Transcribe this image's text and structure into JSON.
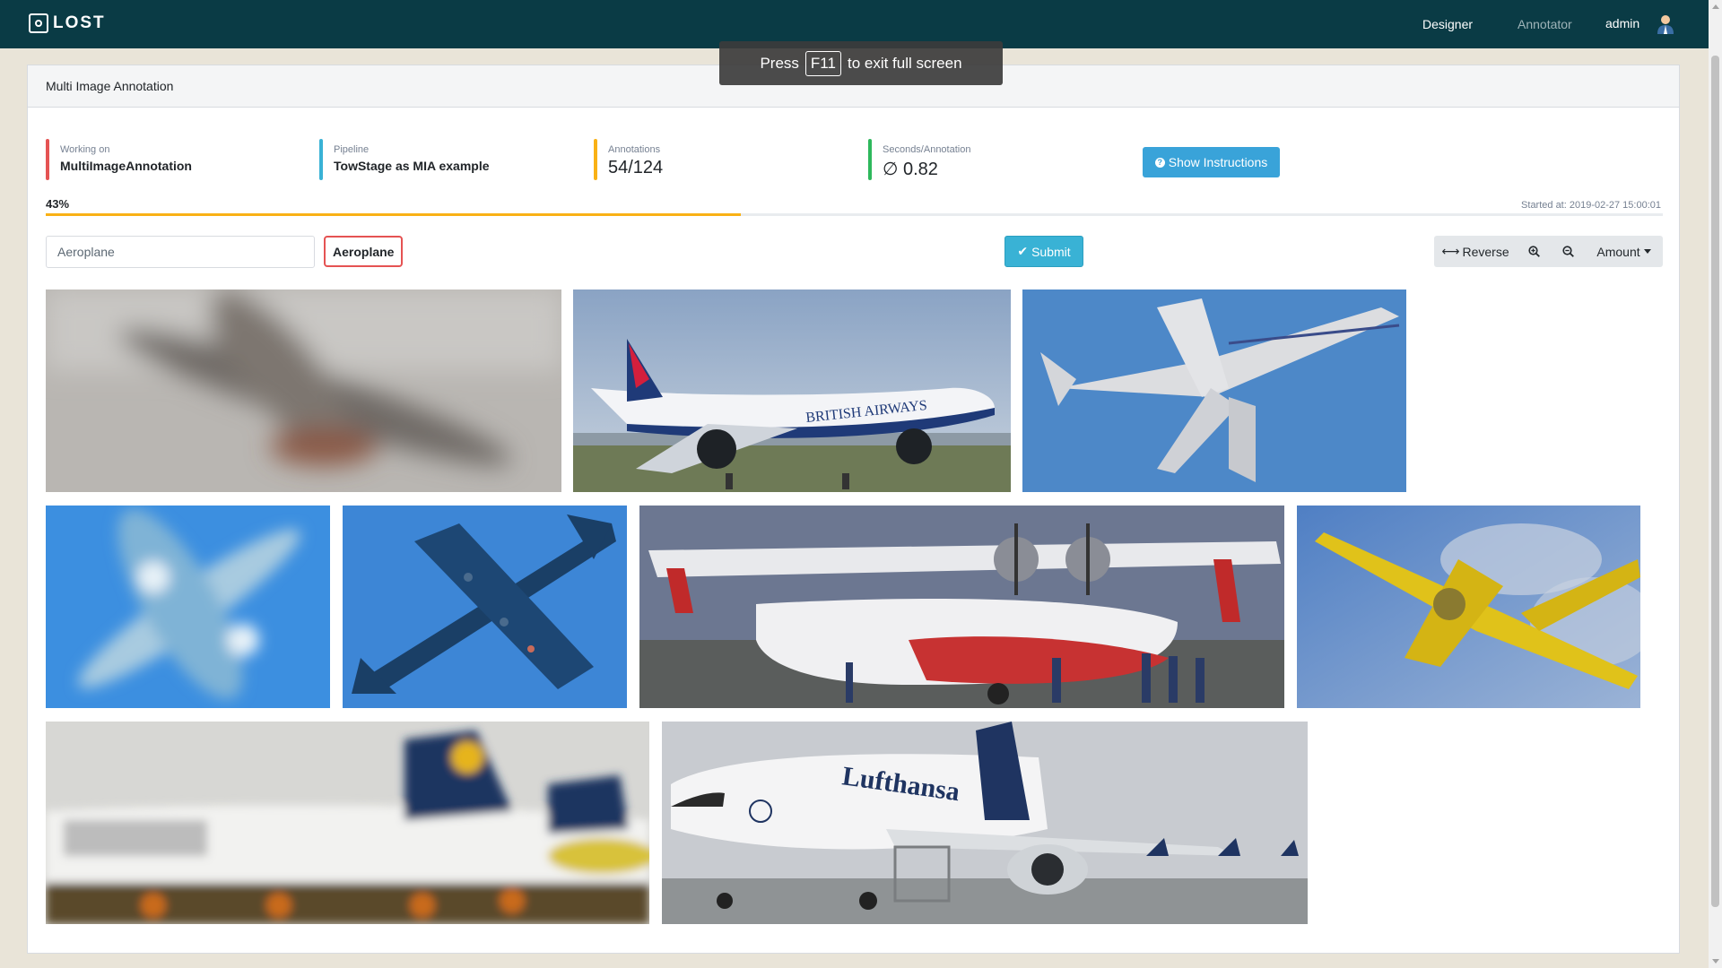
{
  "app": {
    "logo_text": "LOST"
  },
  "nav": {
    "designer": "Designer",
    "annotator": "Annotator",
    "user": "admin"
  },
  "fullscreen_toast": {
    "before": "Press",
    "key": "F11",
    "after": "to exit full screen"
  },
  "card": {
    "title": "Multi Image Annotation"
  },
  "stats": {
    "working_on": {
      "label": "Working on",
      "value": "MultiImageAnnotation"
    },
    "pipeline": {
      "label": "Pipeline",
      "value": "TowStage as MIA example"
    },
    "annotations": {
      "label": "Annotations",
      "value": "54/124"
    },
    "seconds": {
      "label": "Seconds/Annotation",
      "value": "∅ 0.82"
    }
  },
  "buttons": {
    "show_instructions": "Show Instructions",
    "submit": "Submit",
    "reverse": "Reverse",
    "amount": "Amount"
  },
  "progress": {
    "label": "43%",
    "fraction": 0.43,
    "started": "Started at: 2019-02-27 15:00:01"
  },
  "label_input": {
    "value": "Aeroplane"
  },
  "selected_label": "Aeroplane",
  "images": [
    {
      "subject": "blurry aeroplane, grey"
    },
    {
      "subject": "British Airways jet landing"
    },
    {
      "subject": "business jet from below, blue sky"
    },
    {
      "subject": "blurry aeroplane, blue sky"
    },
    {
      "subject": "bomber silhouette, blue sky"
    },
    {
      "subject": "seaplane on ground with crowd"
    },
    {
      "subject": "yellow aerobatic plane"
    },
    {
      "subject": "Lufthansa jets at airport, blurry"
    },
    {
      "subject": "Lufthansa airbus parked"
    }
  ],
  "colors": {
    "topbar": "#0a3b45",
    "progress": "#f9b115",
    "submit": "#39b2d5",
    "label_border": "#e55353"
  }
}
